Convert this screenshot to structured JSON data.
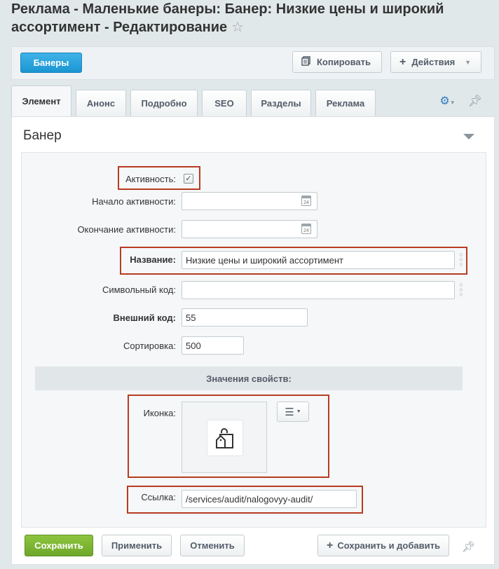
{
  "page": {
    "title": "Реклама - Маленькие банеры: Банер: Низкие цены и широкий ассортимент - Редактирование"
  },
  "toolbar": {
    "banners_label": "Банеры",
    "copy_label": "Копировать",
    "actions_label": "Действия"
  },
  "tabs": [
    {
      "label": "Элемент",
      "active": true
    },
    {
      "label": "Анонс"
    },
    {
      "label": "Подробно"
    },
    {
      "label": "SEO"
    },
    {
      "label": "Разделы"
    },
    {
      "label": "Реклама"
    }
  ],
  "panel": {
    "heading": "Банер"
  },
  "form": {
    "active_label": "Активность:",
    "active_checked": true,
    "start_label": "Начало активности:",
    "start_value": "",
    "end_label": "Окончание активности:",
    "end_value": "",
    "name_label": "Название:",
    "name_value": "Низкие цены  и широкий ассортимент",
    "code_label": "Символьный код:",
    "code_value": "",
    "xml_id_label": "Внешний код:",
    "xml_id_value": "55",
    "sort_label": "Сортировка:",
    "sort_value": "500",
    "props_heading": "Значения свойств:",
    "icon_label": "Иконка:",
    "link_label": "Ссылка:",
    "link_value": "/services/audit/nalogovyy-audit/"
  },
  "buttons": {
    "save": "Сохранить",
    "apply": "Применить",
    "cancel": "Отменить",
    "save_add": "Сохранить и добавить"
  },
  "calendar_day": "24",
  "colors": {
    "accent_blue": "#1b95d2",
    "save_green": "#6ea82a",
    "highlight": "#b83c22"
  }
}
